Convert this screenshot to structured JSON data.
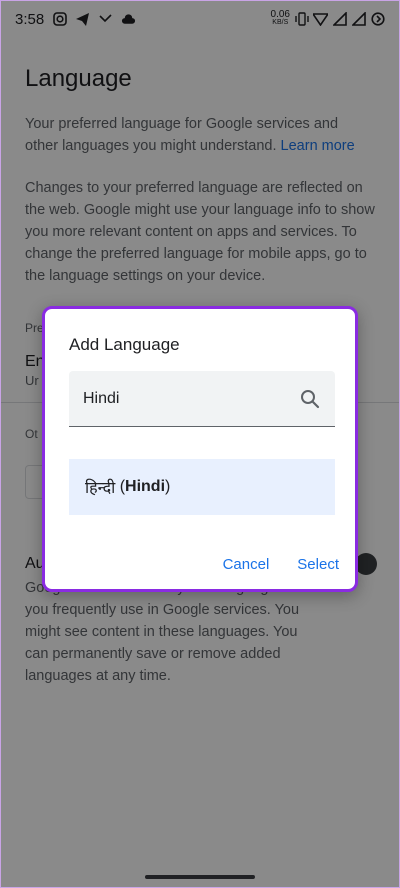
{
  "status_bar": {
    "time": "3:58",
    "speed_value": "0.06",
    "speed_unit": "KB/S"
  },
  "page": {
    "title": "Language",
    "intro": "Your preferred language for Google services and other languages you might understand.",
    "learn_more": "Learn more",
    "changes_text": "Changes to your preferred language are reflected on the web. Google might use your language info to show you more relevant content on apps and services. To change the preferred language for mobile apps, go to the language settings on your device.",
    "preferred_label": "Pre",
    "preferred_lang": "En",
    "preferred_sub": "Ur",
    "other_label": "Ot",
    "auto_title": "Au",
    "auto_desc": "Google will automatically add languages that you frequently use in Google services. You might see content in these languages. You can permanently save or remove added languages at any time."
  },
  "dialog": {
    "title": "Add Language",
    "search_value": "Hindi",
    "result_native": "हिन्दी",
    "result_paren_open": "(",
    "result_bold": "Hindi",
    "result_paren_close": ")",
    "cancel_label": "Cancel",
    "select_label": "Select"
  },
  "colors": {
    "accent": "#1a73e8",
    "dialog_border": "#8a2be2",
    "selected_bg": "#e8f0fe"
  }
}
